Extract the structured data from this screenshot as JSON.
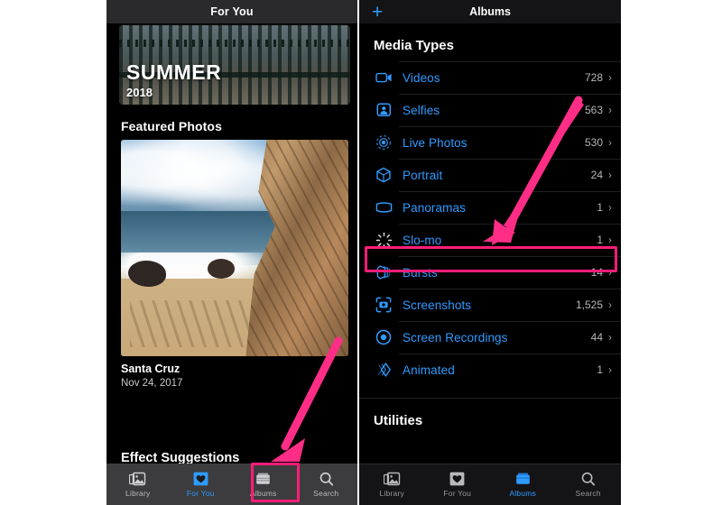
{
  "accent": {
    "blue": "#2f9bff",
    "pink": "#FF1D78",
    "text_secondary": "#b6b6ba"
  },
  "left_phone": {
    "header": {
      "title": "For You"
    },
    "memory_card": {
      "title": "SUMMER",
      "year": "2018",
      "image_name": "summer-memory-fence-photo"
    },
    "featured_section": {
      "title": "Featured Photos",
      "image_name": "santa-cruz-beach-cliff-photo",
      "caption_title": "Santa Cruz",
      "caption_date": "Nov 24, 2017"
    },
    "effect_section": {
      "title": "Effect Suggestions"
    },
    "tabbar": {
      "tabs": [
        {
          "label": "Library",
          "icon": "photos-library-icon",
          "active": false
        },
        {
          "label": "For You",
          "icon": "for-you-heart-icon",
          "active": true
        },
        {
          "label": "Albums",
          "icon": "albums-folder-icon",
          "active": false
        },
        {
          "label": "Search",
          "icon": "search-icon",
          "active": false
        }
      ]
    }
  },
  "right_phone": {
    "header": {
      "title": "Albums",
      "add_button": "+"
    },
    "media_types": {
      "section_title": "Media Types",
      "rows": [
        {
          "label": "Videos",
          "count": "728",
          "icon": "video-camera-icon",
          "chevron": "›"
        },
        {
          "label": "Selfies",
          "count": "563",
          "icon": "selfie-person-icon",
          "chevron": "›"
        },
        {
          "label": "Live Photos",
          "count": "530",
          "icon": "live-photo-icon",
          "chevron": "›"
        },
        {
          "label": "Portrait",
          "count": "24",
          "icon": "portrait-cube-icon",
          "chevron": "›"
        },
        {
          "label": "Panoramas",
          "count": "1",
          "icon": "panorama-icon",
          "chevron": "›"
        },
        {
          "label": "Slo-mo",
          "count": "1",
          "icon": "slo-mo-icon",
          "chevron": "›"
        },
        {
          "label": "Bursts",
          "count": "14",
          "icon": "bursts-stack-icon",
          "chevron": "›"
        },
        {
          "label": "Screenshots",
          "count": "1,525",
          "icon": "screenshots-icon",
          "chevron": "›"
        },
        {
          "label": "Screen Recordings",
          "count": "44",
          "icon": "screen-recording-icon",
          "chevron": "›"
        },
        {
          "label": "Animated",
          "count": "1",
          "icon": "animated-icon",
          "chevron": "›"
        }
      ]
    },
    "utilities": {
      "section_title": "Utilities"
    },
    "tabbar": {
      "tabs": [
        {
          "label": "Library",
          "icon": "photos-library-icon",
          "active": false
        },
        {
          "label": "For You",
          "icon": "for-you-heart-icon",
          "active": false
        },
        {
          "label": "Albums",
          "icon": "albums-folder-icon",
          "active": true
        },
        {
          "label": "Search",
          "icon": "search-icon",
          "active": false
        }
      ]
    }
  },
  "annotations": {
    "highlight_slomo_row": "Slo-mo",
    "highlight_albums_tab": "Albums",
    "arrow_to_slomo": "arrow-pointing-to-slo-mo-row",
    "arrow_to_albums": "arrow-pointing-to-albums-tab"
  }
}
